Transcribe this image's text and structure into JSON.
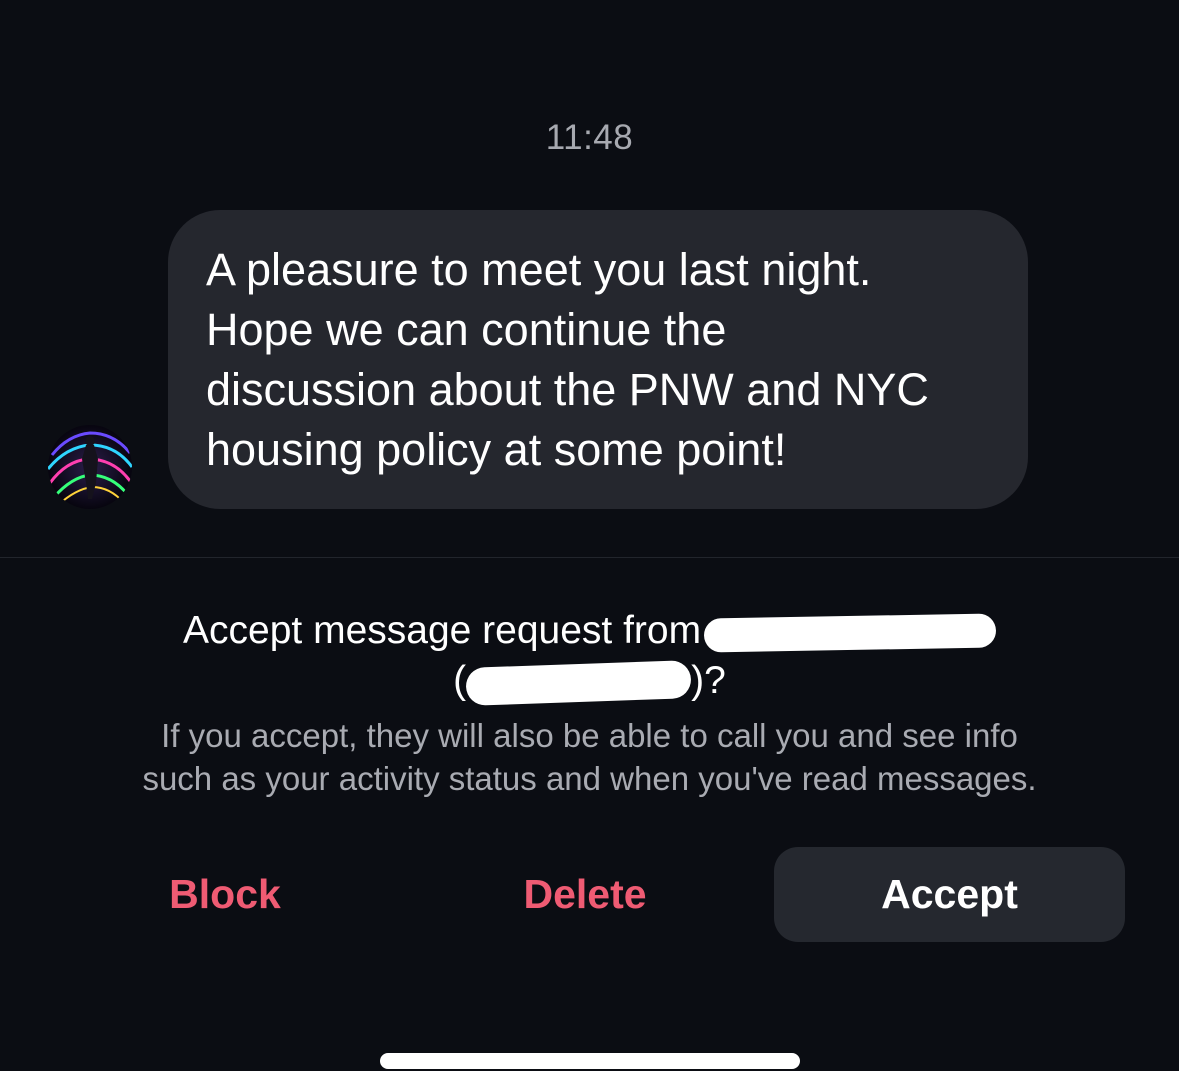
{
  "conversation": {
    "timestamp": "11:48",
    "message": {
      "lines": [
        "A pleasure to meet you last night.",
        "Hope we can continue the",
        "discussion about the PNW and NYC",
        "housing policy at some point!"
      ]
    },
    "avatar": {
      "icon": "profile-photo"
    }
  },
  "request": {
    "title_prefix": "Accept message request from",
    "handle_open": "(",
    "handle_close": ")?",
    "subtitle_line1": "If you accept, they will also be able to call you and see info",
    "subtitle_line2": "such as your activity status and when you've read messages."
  },
  "actions": {
    "block_label": "Block",
    "delete_label": "Delete",
    "accept_label": "Accept"
  },
  "colors": {
    "background": "#0b0d13",
    "bubble": "#25272e",
    "destructive": "#ef5b73",
    "accept_button": "#25282f"
  }
}
